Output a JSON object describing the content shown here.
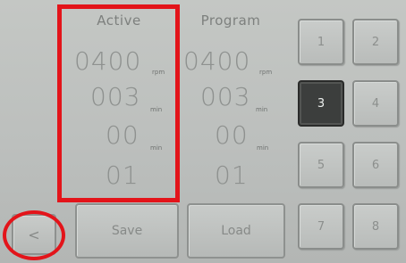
{
  "active": {
    "title": "Active",
    "speed": {
      "value": "0400",
      "unit": "rpm"
    },
    "time1": {
      "value": "003",
      "unit": "min"
    },
    "time2": {
      "value": "00",
      "unit": "min"
    },
    "step": {
      "value": "01"
    }
  },
  "program": {
    "title": "Program",
    "speed": {
      "value": "0400",
      "unit": "rpm"
    },
    "time1": {
      "value": "003",
      "unit": "min"
    },
    "time2": {
      "value": "00",
      "unit": "min"
    },
    "step": {
      "value": "01"
    }
  },
  "keypad": {
    "keys": [
      "1",
      "2",
      "3",
      "4",
      "5",
      "6",
      "7",
      "8"
    ],
    "selected": "3"
  },
  "buttons": {
    "back_label": "<",
    "save_label": "Save",
    "load_label": "Load"
  },
  "colors": {
    "highlight": "#e3141a",
    "selected_key": "#3c3e3d"
  }
}
